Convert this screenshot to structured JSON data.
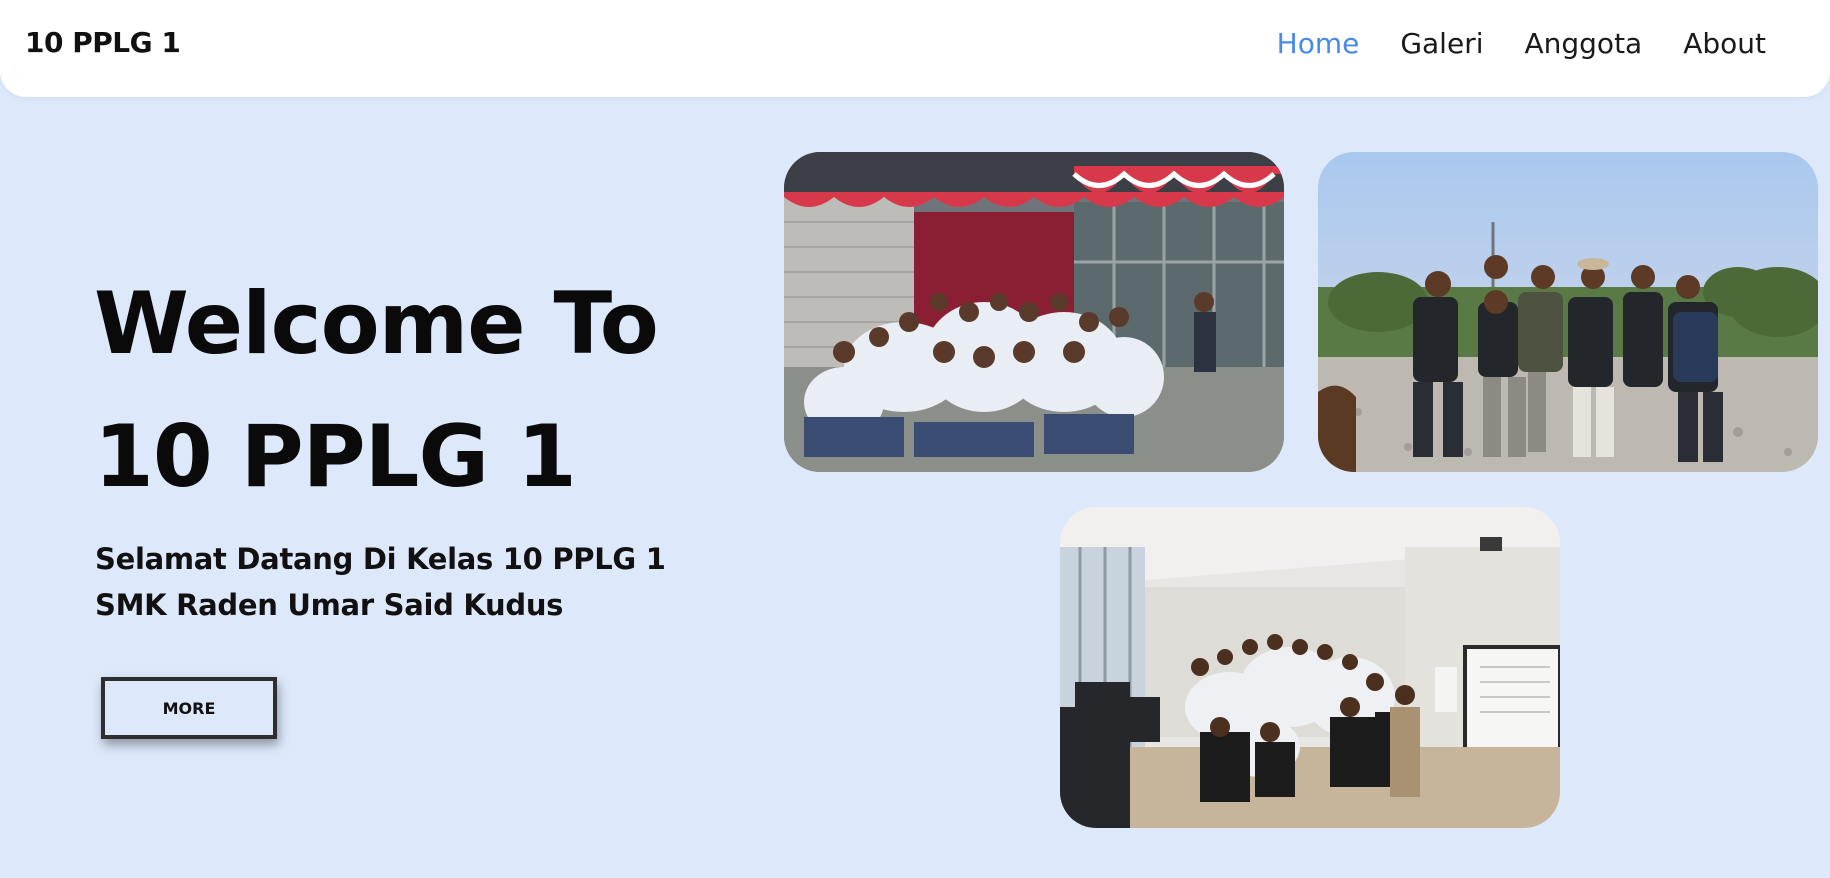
{
  "nav": {
    "brand": "10 PPLG 1",
    "links": [
      "Home",
      "Galeri",
      "Anggota",
      "About"
    ],
    "active": "Home"
  },
  "hero": {
    "title_line1": "Welcome To",
    "title_line2": "10 PPLG 1",
    "subtitle_line1": "Selamat Datang Di Kelas 10 PPLG 1",
    "subtitle_line2": "SMK Raden Umar Said Kudus",
    "button_label": "MORE"
  },
  "colors": {
    "background": "#dde9fb",
    "nav_background": "#ffffff",
    "active_link": "#4a8ae6",
    "text": "#111111"
  }
}
